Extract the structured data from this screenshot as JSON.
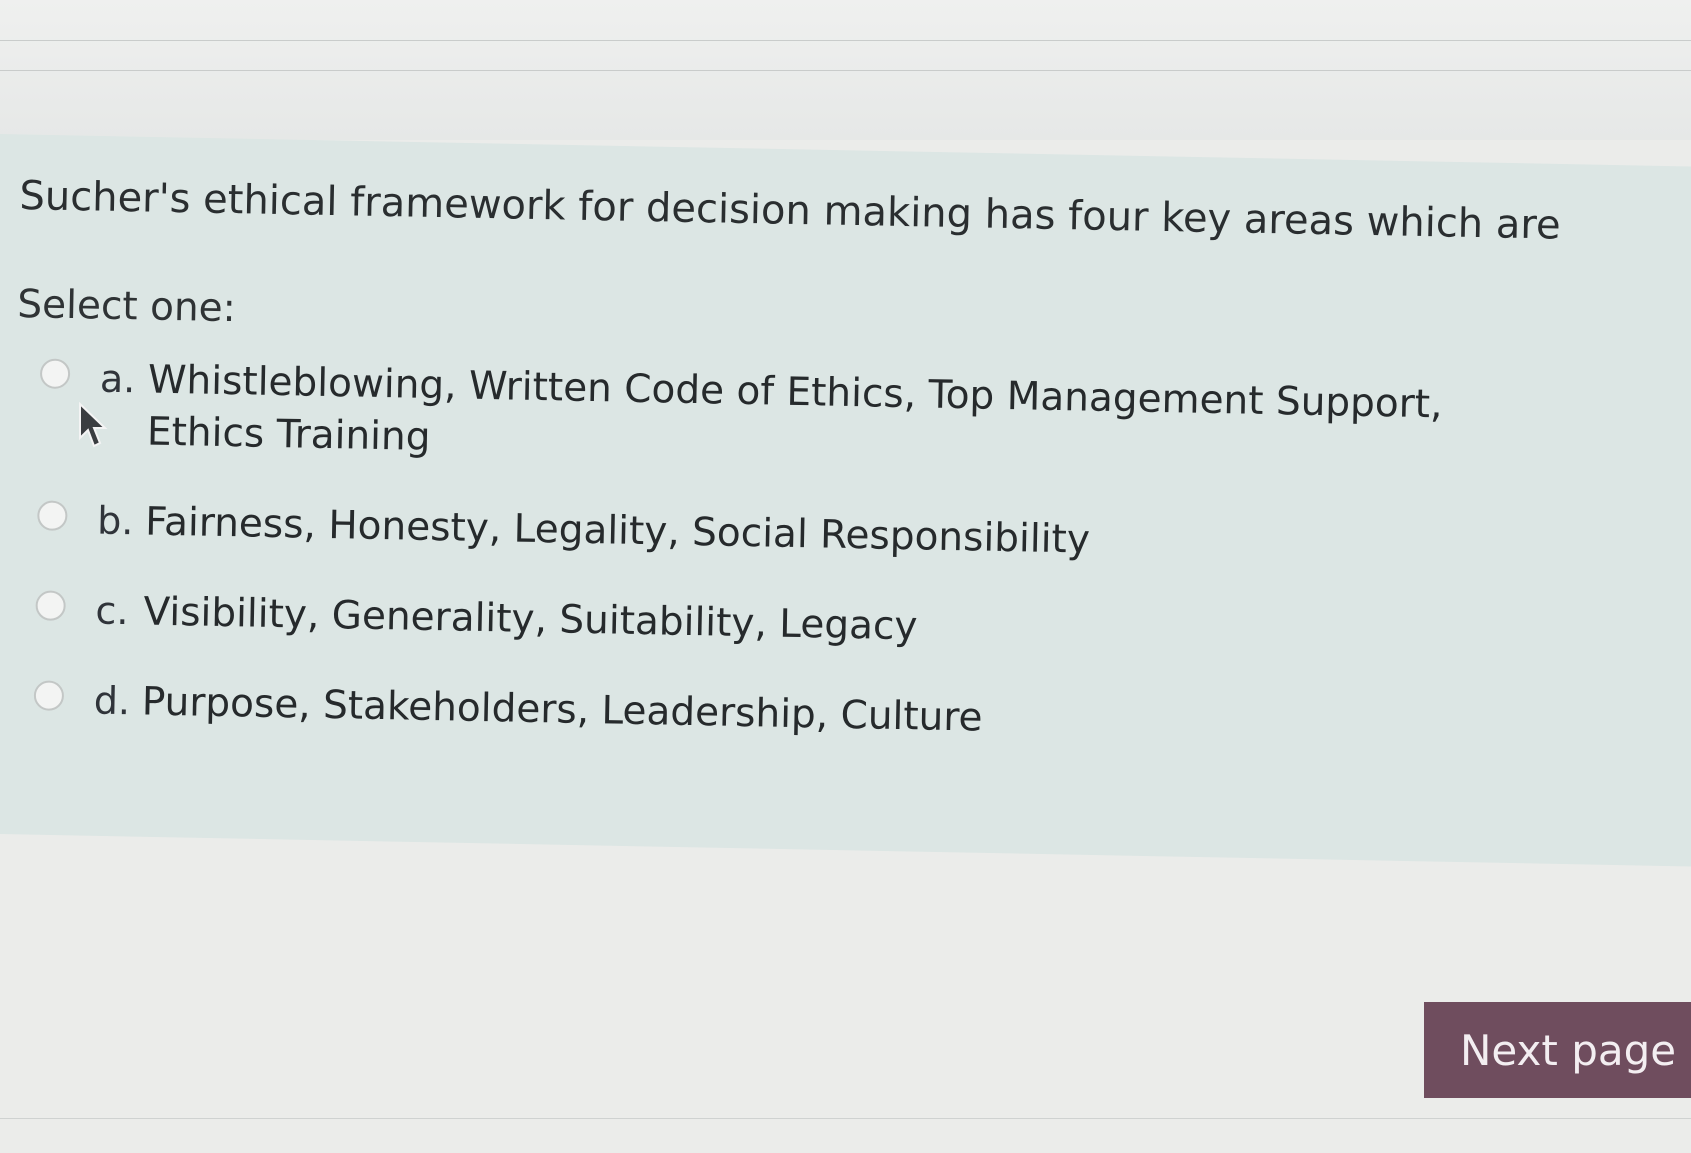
{
  "question": {
    "text": "Sucher's ethical framework for decision making has four key areas which are",
    "prompt": "Select one:",
    "options": [
      {
        "letter": "a.",
        "text": "Whistleblowing, Written Code of Ethics, Top Management Support, Ethics Training"
      },
      {
        "letter": "b.",
        "text": "Fairness, Honesty, Legality, Social Responsibility"
      },
      {
        "letter": "c.",
        "text": "Visibility, Generality, Suitability, Legacy"
      },
      {
        "letter": "d.",
        "text": "Purpose, Stakeholders, Leadership, Culture"
      }
    ]
  },
  "navigation": {
    "next_label": "Next page"
  },
  "colors": {
    "panel_background": "#dce6e4",
    "next_button_background": "#6f4d5e"
  }
}
